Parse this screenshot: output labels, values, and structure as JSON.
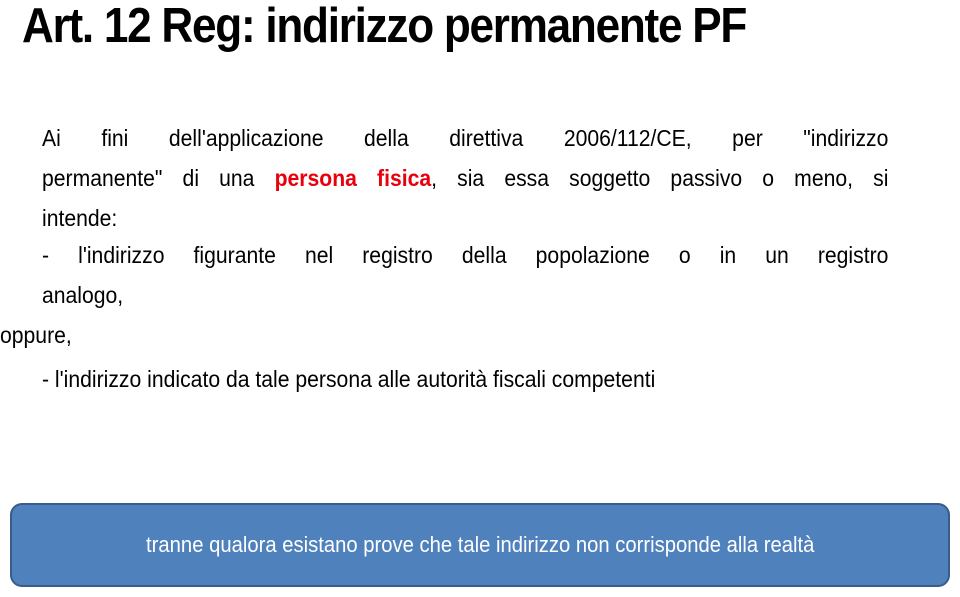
{
  "slide": {
    "title": "Art. 12 Reg: indirizzo permanente PF",
    "intro": {
      "line1": "Ai fini dell'applicazione della direttiva 2006/112/CE, per \"indirizzo",
      "line2_before": "permanente\" di una ",
      "line2_highlight": "persona fisica",
      "line2_after": ", sia essa soggetto passivo o meno, si",
      "line3": "intende:"
    },
    "item1": {
      "line1": "- l'indirizzo figurante nel registro della popolazione o in un registro",
      "line2": "analogo,"
    },
    "connector": "oppure,",
    "item2": "- l'indirizzo indicato da tale persona alle autorità fiscali competenti",
    "callout": "tranne qualora esistano prove che tale indirizzo non corrisponde alla realtà"
  },
  "colors": {
    "highlight": "#e8000d",
    "callout_fill": "#4f81bd",
    "callout_border": "#385d8a",
    "callout_text": "#ffffff"
  }
}
